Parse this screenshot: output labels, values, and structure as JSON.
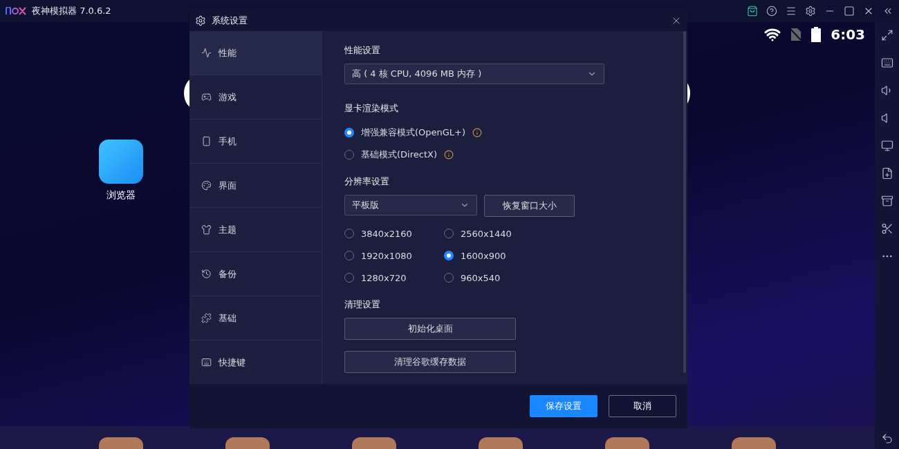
{
  "title_bar": {
    "app_name": "夜神模拟器 7.0.6.2"
  },
  "android": {
    "status_time": "6:03",
    "apps": [
      {
        "label": "浏览器"
      }
    ]
  },
  "dialog": {
    "title": "系统设置",
    "nav": [
      {
        "label": "性能",
        "selected": true
      },
      {
        "label": "游戏",
        "selected": false
      },
      {
        "label": "手机",
        "selected": false
      },
      {
        "label": "界面",
        "selected": false
      },
      {
        "label": "主题",
        "selected": false
      },
      {
        "label": "备份",
        "selected": false
      },
      {
        "label": "基础",
        "selected": false
      },
      {
        "label": "快捷键",
        "selected": false
      }
    ],
    "performance": {
      "heading": "性能设置",
      "select": {
        "value": "高 ( 4 核 CPU, 4096 MB 内存 )"
      }
    },
    "render": {
      "heading": "显卡渲染模式",
      "options": [
        {
          "label": "增强兼容模式(OpenGL+)",
          "selected": true
        },
        {
          "label": "基础模式(DirectX)",
          "selected": false
        }
      ]
    },
    "resolution": {
      "heading": "分辨率设置",
      "select": {
        "value": "平板版"
      },
      "restore_button": "恢复窗口大小",
      "options": [
        {
          "label": "3840x2160",
          "selected": false
        },
        {
          "label": "2560x1440",
          "selected": false
        },
        {
          "label": "1920x1080",
          "selected": false
        },
        {
          "label": "1600x900",
          "selected": true
        },
        {
          "label": "1280x720",
          "selected": false
        },
        {
          "label": "960x540",
          "selected": false
        }
      ]
    },
    "cleanup": {
      "heading": "清理设置",
      "buttons": [
        "初始化桌面",
        "清理谷歌缓存数据"
      ]
    },
    "footer_buttons": [
      {
        "label": "保存设置",
        "kind": "primary"
      },
      {
        "label": "取消",
        "kind": "secondary"
      }
    ]
  }
}
